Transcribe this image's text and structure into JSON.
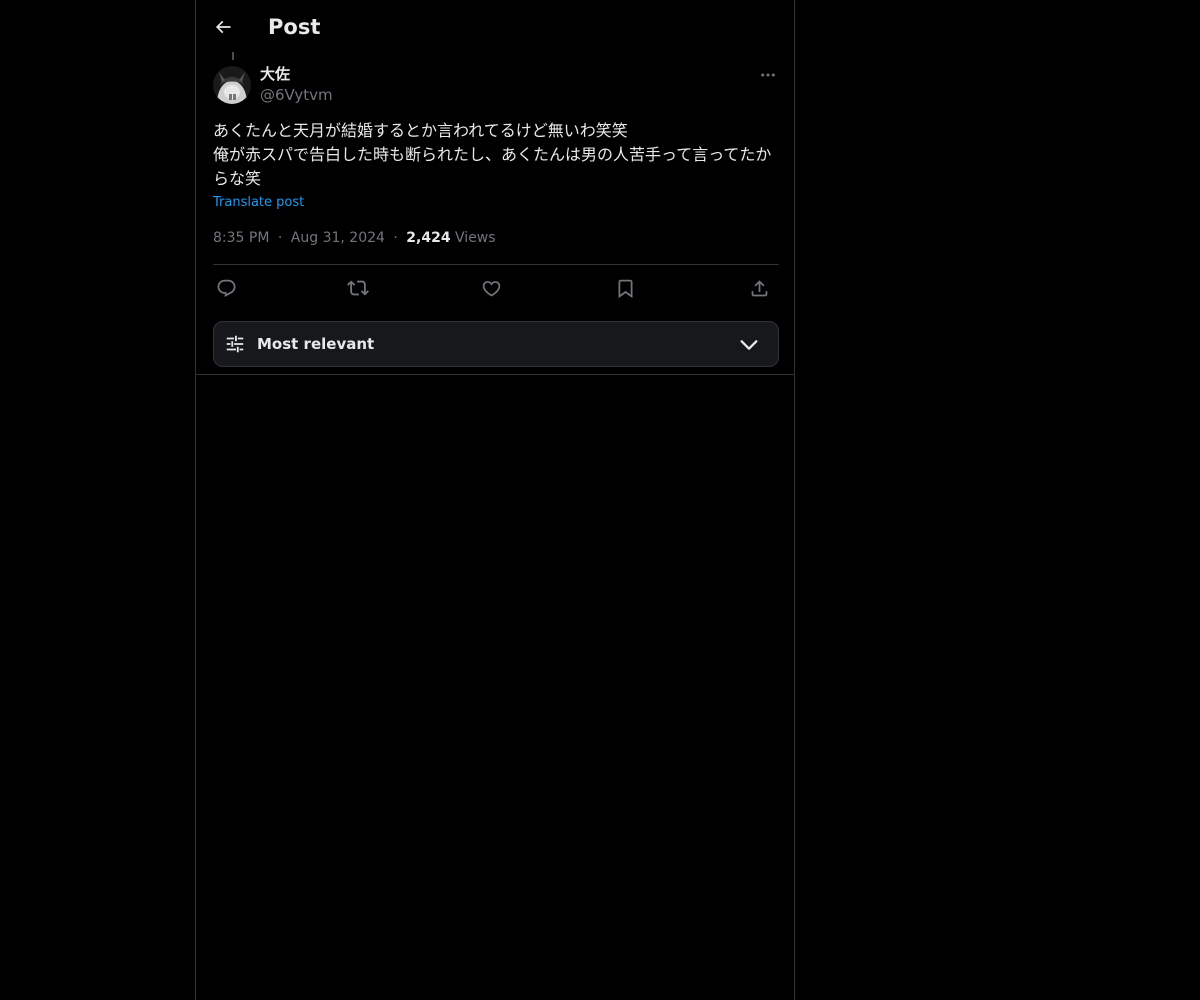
{
  "header": {
    "back_icon": "arrow-left-icon",
    "title": "Post"
  },
  "post": {
    "author": {
      "avatar": "avatar",
      "name": "大佐",
      "handle": "@6Vytvm"
    },
    "more_icon": "ellipsis-icon",
    "text": "あくたんと天月が結婚するとか言われてるけど無いわ笑笑\n俺が赤スパで告白した時も断られたし、あくたんは男の人苦手って言ってたからな笑",
    "translate_label": "Translate post",
    "time": "8:35 PM",
    "separator": "·",
    "date": "Aug 31, 2024",
    "views_count": "2,424",
    "views_label": "Views",
    "actions": {
      "reply_icon": "reply-icon",
      "repost_icon": "repost-icon",
      "like_icon": "heart-icon",
      "bookmark_icon": "bookmark-icon",
      "share_icon": "share-icon"
    }
  },
  "sort": {
    "icon": "sliders-icon",
    "label": "Most relevant",
    "chevron": "chevron-down-icon"
  },
  "colors": {
    "background": "#000000",
    "text": "#e7e9ea",
    "secondary_text": "#71767b",
    "link": "#1d9bf0",
    "border": "#2f3336"
  }
}
